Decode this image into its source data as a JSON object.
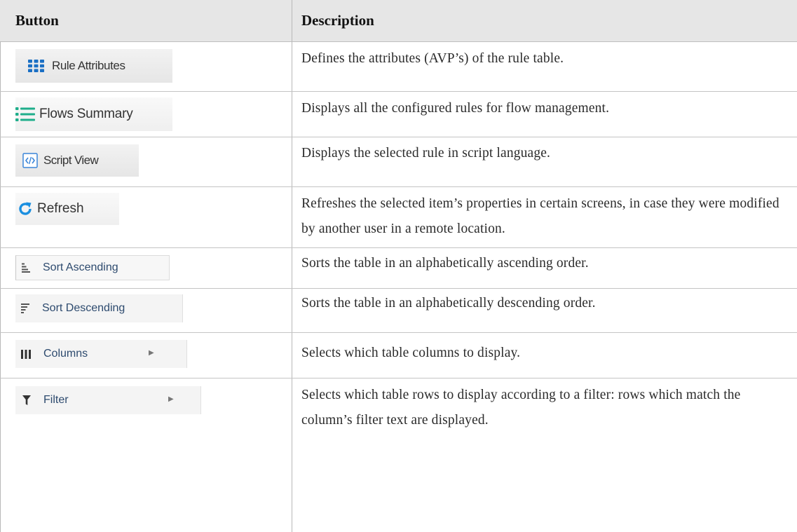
{
  "table": {
    "header": {
      "button": "Button",
      "description": "Description"
    },
    "rows": [
      {
        "button_label": "Rule Attributes",
        "icon": "grid-icon",
        "description": "Defines the attributes (AVP’s) of the rule table."
      },
      {
        "button_label": "Flows Summary",
        "icon": "list-icon",
        "description": "Displays all the configured rules for flow management."
      },
      {
        "button_label": "Script View",
        "icon": "script-code-icon",
        "description": "Displays the selected rule in script language."
      },
      {
        "button_label": "Refresh",
        "icon": "refresh-icon",
        "description": "Refreshes the selected item’s properties in certain screens, in case they were modified by another user in a remote location."
      },
      {
        "button_label": "Sort Ascending",
        "icon": "sort-ascending-icon",
        "description": "Sorts the table in an alphabetically ascending order."
      },
      {
        "button_label": "Sort Descending",
        "icon": "sort-descending-icon",
        "description": "Sorts the table in an alphabetically descending order."
      },
      {
        "button_label": "Columns",
        "icon": "columns-icon",
        "submenu_arrow": "▶",
        "description": "Selects which table columns to display."
      },
      {
        "button_label": "Filter",
        "icon": "filter-icon",
        "submenu_arrow": "▶",
        "description": "Selects which table rows to display according to a filter: rows which match the column’s filter text are displayed."
      }
    ]
  },
  "colors": {
    "header_bg": "#e6e6e6",
    "icon_blue": "#1a6fc4",
    "icon_teal": "#1fae8b",
    "icon_refresh": "#1b8fe0",
    "menu_text": "#2d4a6e",
    "grid_line": "#c4c4c4"
  }
}
